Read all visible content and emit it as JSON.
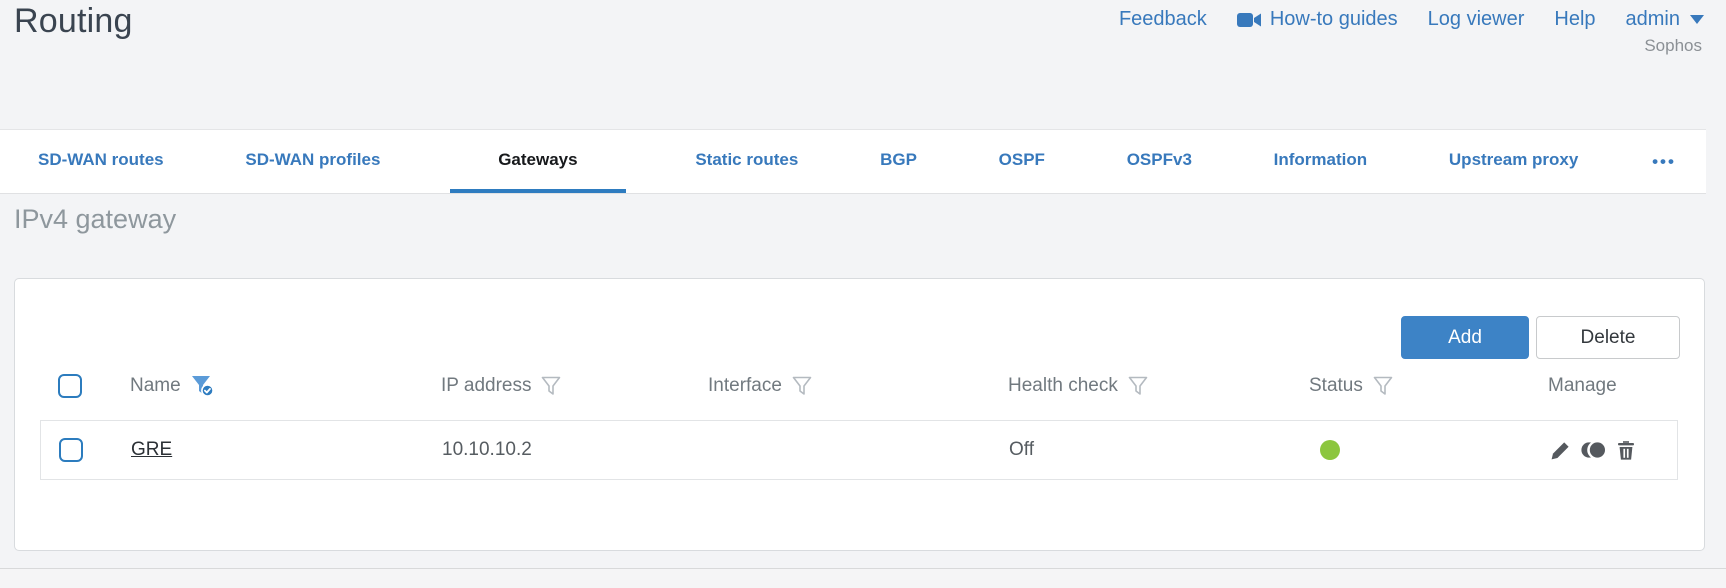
{
  "page": {
    "title": "Routing",
    "tenant": "Sophos"
  },
  "top_nav": {
    "feedback": "Feedback",
    "how_to_guides": "How-to guides",
    "how_to_icon": "video-camera-icon",
    "log_viewer": "Log viewer",
    "help": "Help",
    "user": "admin",
    "user_icon": "chevron-down-icon"
  },
  "tabs": [
    {
      "label": "SD-WAN routes",
      "active": false
    },
    {
      "label": "SD-WAN profiles",
      "active": false
    },
    {
      "label": "Gateways",
      "active": true
    },
    {
      "label": "Static routes",
      "active": false
    },
    {
      "label": "BGP",
      "active": false
    },
    {
      "label": "OSPF",
      "active": false
    },
    {
      "label": "OSPFv3",
      "active": false
    },
    {
      "label": "Information",
      "active": false
    },
    {
      "label": "Upstream proxy",
      "active": false
    }
  ],
  "tabs_more_label": "•••",
  "section": {
    "title": "IPv4 gateway"
  },
  "toolbar": {
    "add_label": "Add",
    "delete_label": "Delete"
  },
  "table": {
    "columns": [
      {
        "label": "Name",
        "filter": "active",
        "filter_icon": "filter-funnel-checked-icon"
      },
      {
        "label": "IP address",
        "filter": "inactive",
        "filter_icon": "filter-funnel-icon"
      },
      {
        "label": "Interface",
        "filter": "inactive",
        "filter_icon": "filter-funnel-icon"
      },
      {
        "label": "Health check",
        "filter": "inactive",
        "filter_icon": "filter-funnel-icon"
      },
      {
        "label": "Status",
        "filter": "inactive",
        "filter_icon": "filter-funnel-icon"
      },
      {
        "label": "Manage",
        "filter": "none"
      }
    ],
    "rows": [
      {
        "name": "GRE",
        "ip_address": "10.10.10.2",
        "interface": "",
        "health_check": "Off",
        "status": "up",
        "status_color": "#8cc63e",
        "manage": [
          "edit",
          "clone",
          "delete"
        ]
      }
    ]
  },
  "colors": {
    "accent_blue": "#3879bc",
    "button_blue": "#3d83c6",
    "active_tab_underline": "#2e7cc0",
    "status_green": "#8cc63e",
    "title_gray": "#8e979d",
    "text_dark": "#3a4450"
  }
}
